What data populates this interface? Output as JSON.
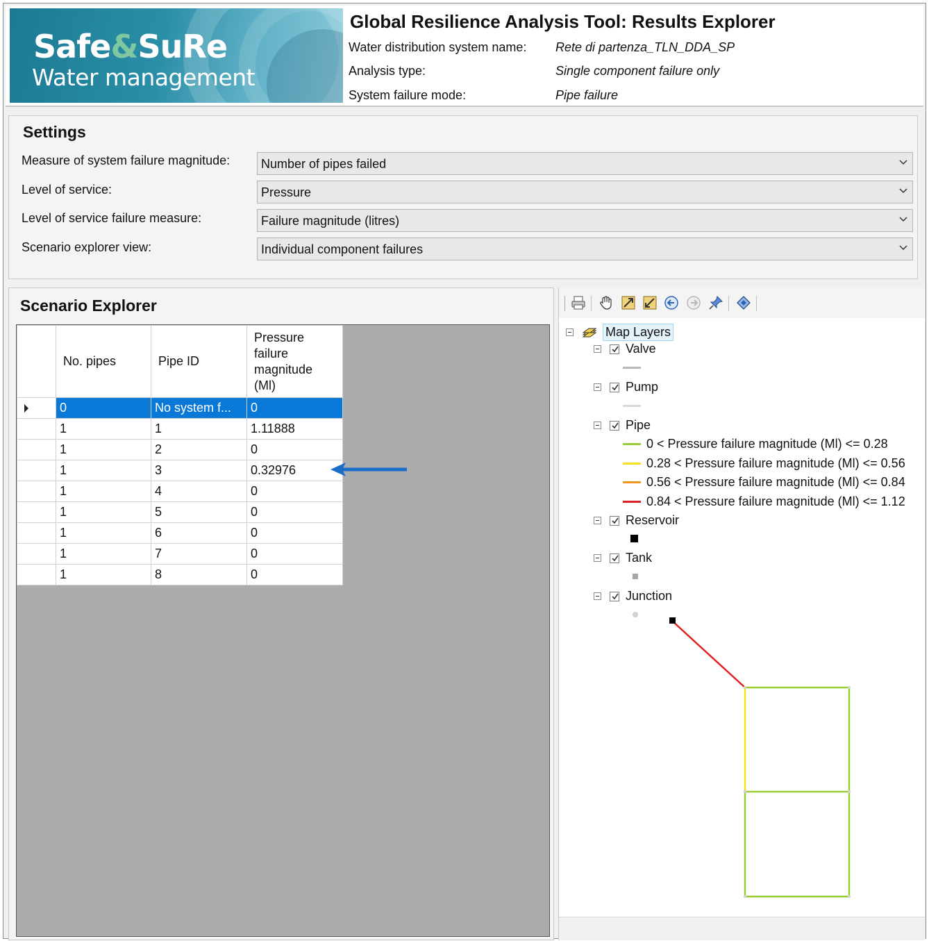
{
  "header": {
    "logo_title_a": "Safe",
    "logo_title_amp": "&",
    "logo_title_b": "SuRe",
    "logo_subtitle": "Water management",
    "app_title": "Global Resilience Analysis Tool: Results Explorer",
    "info": [
      {
        "label": "Water distribution system name:",
        "value": "Rete di partenza_TLN_DDA_SP"
      },
      {
        "label": "Analysis type:",
        "value": "Single component failure only"
      },
      {
        "label": "System failure mode:",
        "value": "Pipe failure"
      }
    ]
  },
  "settings": {
    "title": "Settings",
    "rows": [
      {
        "label": "Measure of system failure magnitude:",
        "value": "Number of pipes failed"
      },
      {
        "label": "Level of service:",
        "value": "Pressure"
      },
      {
        "label": "Level of service failure measure:",
        "value": "Failure magnitude (litres)"
      },
      {
        "label": "Scenario explorer view:",
        "value": "Individual component failures"
      }
    ]
  },
  "scenario": {
    "title": "Scenario Explorer",
    "columns": [
      "No. pipes",
      "Pipe ID",
      "Pressure failure magnitude (Ml)"
    ],
    "rows": [
      [
        "0",
        "No system f...",
        "0"
      ],
      [
        "1",
        "1",
        "1.11888"
      ],
      [
        "1",
        "2",
        "0"
      ],
      [
        "1",
        "3",
        "0.32976"
      ],
      [
        "1",
        "4",
        "0"
      ],
      [
        "1",
        "5",
        "0"
      ],
      [
        "1",
        "6",
        "0"
      ],
      [
        "1",
        "7",
        "0"
      ],
      [
        "1",
        "8",
        "0"
      ]
    ],
    "selected_row": 0
  },
  "map": {
    "root_label": "Map Layers",
    "layers": {
      "valve": "Valve",
      "pump": "Pump",
      "pipe": "Pipe",
      "reservoir": "Reservoir",
      "tank": "Tank",
      "junction": "Junction"
    },
    "pipe_legend": [
      {
        "label": "0 < Pressure failure magnitude (Ml) <= 0.28",
        "color": "#9acd32"
      },
      {
        "label": "0.28 < Pressure failure magnitude (Ml) <= 0.56",
        "color": "#f2e01e"
      },
      {
        "label": "0.56 < Pressure failure magnitude (Ml) <= 0.84",
        "color": "#f0941e"
      },
      {
        "label": "0.84 < Pressure failure magnitude (Ml) <= 1.12",
        "color": "#e02020"
      }
    ],
    "symbol_colors": {
      "valve": "#b8b8b8",
      "pump": "#d8d8d8",
      "reservoir": "#000000",
      "tank": "#a8a8a8",
      "junction": "#d0d0d0"
    },
    "toolbar_icons": [
      "print-icon",
      "pan-hand-icon",
      "zoom-in-icon",
      "zoom-out-icon",
      "back-icon",
      "forward-icon",
      "pin-icon",
      "layers-icon"
    ]
  },
  "colors": {
    "selection": "#0a78d6",
    "annotation_arrow": "#1a6ec8"
  }
}
